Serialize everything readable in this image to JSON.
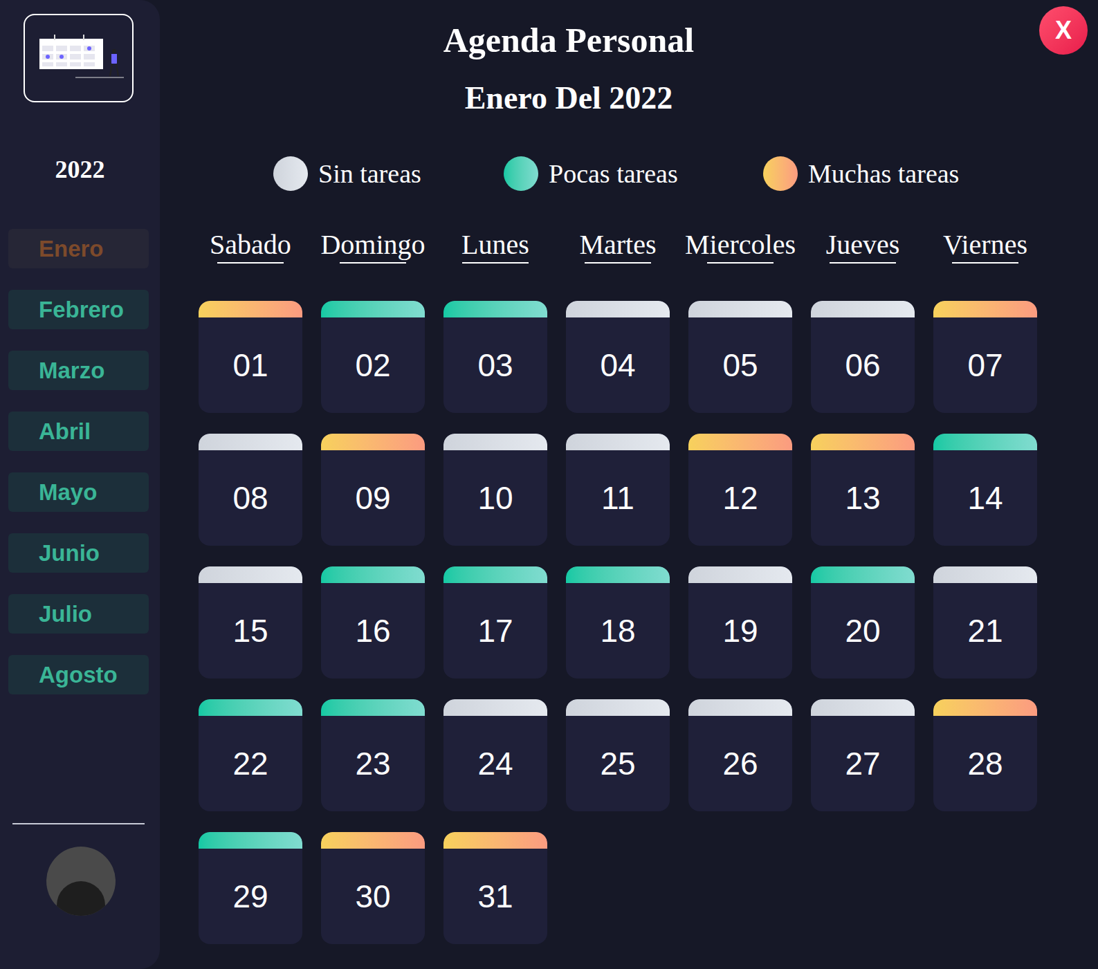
{
  "sidebar": {
    "year": "2022",
    "months": [
      {
        "label": "Enero",
        "selected": true
      },
      {
        "label": "Febrero",
        "selected": false
      },
      {
        "label": "Marzo",
        "selected": false
      },
      {
        "label": "Abril",
        "selected": false
      },
      {
        "label": "Mayo",
        "selected": false
      },
      {
        "label": "Junio",
        "selected": false
      },
      {
        "label": "Julio",
        "selected": false
      },
      {
        "label": "Agosto",
        "selected": false
      }
    ]
  },
  "title": "Agenda Personal",
  "subtitle": "Enero Del 2022",
  "close": "X",
  "legend": [
    {
      "label": "Sin tareas",
      "tasks": "none"
    },
    {
      "label": "Pocas tareas",
      "tasks": "few"
    },
    {
      "label": "Muchas tareas",
      "tasks": "many"
    }
  ],
  "weekdays": [
    "Sabado",
    "Domingo",
    "Lunes",
    "Martes",
    "Miercoles",
    "Jueves",
    "Viernes"
  ],
  "days": [
    {
      "label": "01",
      "tasks": "many"
    },
    {
      "label": "02",
      "tasks": "few"
    },
    {
      "label": "03",
      "tasks": "few"
    },
    {
      "label": "04",
      "tasks": "none"
    },
    {
      "label": "05",
      "tasks": "none"
    },
    {
      "label": "06",
      "tasks": "none"
    },
    {
      "label": "07",
      "tasks": "many"
    },
    {
      "label": "08",
      "tasks": "none"
    },
    {
      "label": "09",
      "tasks": "many"
    },
    {
      "label": "10",
      "tasks": "none"
    },
    {
      "label": "11",
      "tasks": "none"
    },
    {
      "label": "12",
      "tasks": "many"
    },
    {
      "label": "13",
      "tasks": "many"
    },
    {
      "label": "14",
      "tasks": "few"
    },
    {
      "label": "15",
      "tasks": "none"
    },
    {
      "label": "16",
      "tasks": "few"
    },
    {
      "label": "17",
      "tasks": "few"
    },
    {
      "label": "18",
      "tasks": "few"
    },
    {
      "label": "19",
      "tasks": "none"
    },
    {
      "label": "20",
      "tasks": "few"
    },
    {
      "label": "21",
      "tasks": "none"
    },
    {
      "label": "22",
      "tasks": "few"
    },
    {
      "label": "23",
      "tasks": "few"
    },
    {
      "label": "24",
      "tasks": "none"
    },
    {
      "label": "25",
      "tasks": "none"
    },
    {
      "label": "26",
      "tasks": "none"
    },
    {
      "label": "27",
      "tasks": "none"
    },
    {
      "label": "28",
      "tasks": "many"
    },
    {
      "label": "29",
      "tasks": "few"
    },
    {
      "label": "30",
      "tasks": "many"
    },
    {
      "label": "31",
      "tasks": "many"
    }
  ]
}
